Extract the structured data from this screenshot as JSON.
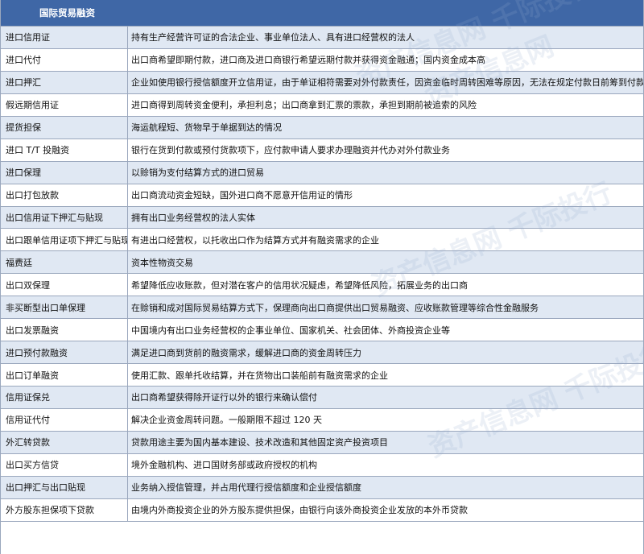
{
  "table": {
    "header": "国际贸易融资",
    "rows": [
      {
        "term": "进口信用证",
        "desc": "持有生产经营许可证的合法企业、事业单位法人、具有进口经营权的法人"
      },
      {
        "term": "进口代付",
        "desc": "出口商希望即期付款，进口商及进口商银行希望远期付款并获得资金融通；国内资金成本高"
      },
      {
        "term": "进口押汇",
        "desc": "企业如使用银行授信额度开立信用证，由于单证相符需要对外付款责任，因资金临时周转困难等原因，无法在规定付款日前筹到付款资金的"
      },
      {
        "term": "假远期信用证",
        "desc": "进口商得到周转资金便利，承担利息；出口商拿到汇票的票款，承担到期前被追索的风险"
      },
      {
        "term": "提货担保",
        "desc": "海运航程短、货物早于单据到达的情况"
      },
      {
        "term": "进口 T/T 投融资",
        "desc": "银行在货到付款或预付货款项下，应付款申请人要求办理融资并代办对外付款业务"
      },
      {
        "term": "进口保理",
        "desc": "以赊销为支付结算方式的进口贸易"
      },
      {
        "term": "出口打包放款",
        "desc": "出口商流动资金短缺，国外进口商不愿意开信用证的情形"
      },
      {
        "term": "出口信用证下押汇与贴现",
        "desc": "拥有出口业务经营权的法人实体"
      },
      {
        "term": "出口跟单信用证项下押汇与贴现",
        "desc": "有进出口经营权，以托收出口作为结算方式并有融资需求的企业"
      },
      {
        "term": "福费廷",
        "desc": "资本性物资交易"
      },
      {
        "term": "出口双保理",
        "desc": "希望降低应收账款，但对潜在客户的信用状况疑虑，希望降低风险，拓展业务的出口商"
      },
      {
        "term": "非买断型出口单保理",
        "desc": "在赊销和成对国际贸易结算方式下，保理商向出口商提供出口贸易融资、应收账款管理等综合性金融服务"
      },
      {
        "term": "出口发票融资",
        "desc": "中国境内有出口业务经营权的企事业单位、国家机关、社会团体、外商投资企业等"
      },
      {
        "term": "进口预付款融资",
        "desc": "满足进口商到货前的融资需求，缓解进口商的资金周转压力"
      },
      {
        "term": "出口订单融资",
        "desc": "使用汇款、跟单托收结算，并在货物出口装船前有融资需求的企业"
      },
      {
        "term": "信用证保兑",
        "desc": "出口商希望获得除开证行以外的银行来确认偿付"
      },
      {
        "term": "信用证代付",
        "desc": "解决企业资金周转问题。一般期限不超过 120 天"
      },
      {
        "term": "外汇转贷款",
        "desc": "贷款用途主要为国内基本建设、技术改造和其他固定资产投资项目"
      },
      {
        "term": "出口买方信贷",
        "desc": "境外金融机构、进口国财务部或政府授权的机构"
      },
      {
        "term": "出口押汇与出口贴现",
        "desc": "业务纳入授信管理，并占用代理行授信额度和企业授信额度"
      },
      {
        "term": "外方股东担保项下贷款",
        "desc": "由境内外商投资企业的外方股东提供担保，由银行向该外商投资企业发放的本外币贷款"
      }
    ]
  }
}
